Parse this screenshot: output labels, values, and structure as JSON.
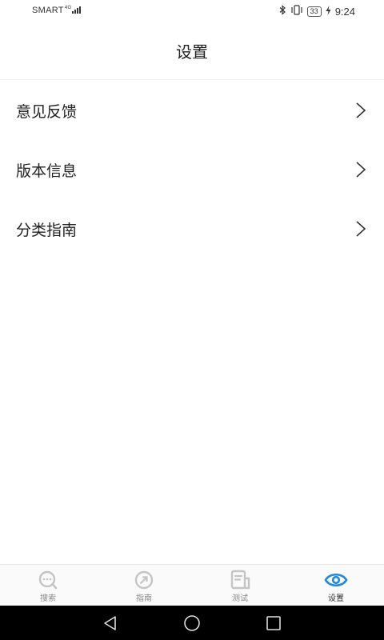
{
  "status_bar": {
    "carrier": "SMART",
    "network": "4G",
    "battery": "33",
    "time": "9:24"
  },
  "header": {
    "title": "设置"
  },
  "settings_list": {
    "items": [
      {
        "label": "意见反馈"
      },
      {
        "label": "版本信息"
      },
      {
        "label": "分类指南"
      }
    ]
  },
  "tabbar": {
    "tabs": [
      {
        "label": "搜索",
        "icon": "search-chat-icon",
        "active": false
      },
      {
        "label": "指南",
        "icon": "compass-icon",
        "active": false
      },
      {
        "label": "测试",
        "icon": "document-icon",
        "active": false
      },
      {
        "label": "设置",
        "icon": "eye-icon",
        "active": true
      }
    ]
  },
  "colors": {
    "accent": "#1e88e5",
    "inactive_icon": "#c4c4c4",
    "text": "#222222"
  }
}
